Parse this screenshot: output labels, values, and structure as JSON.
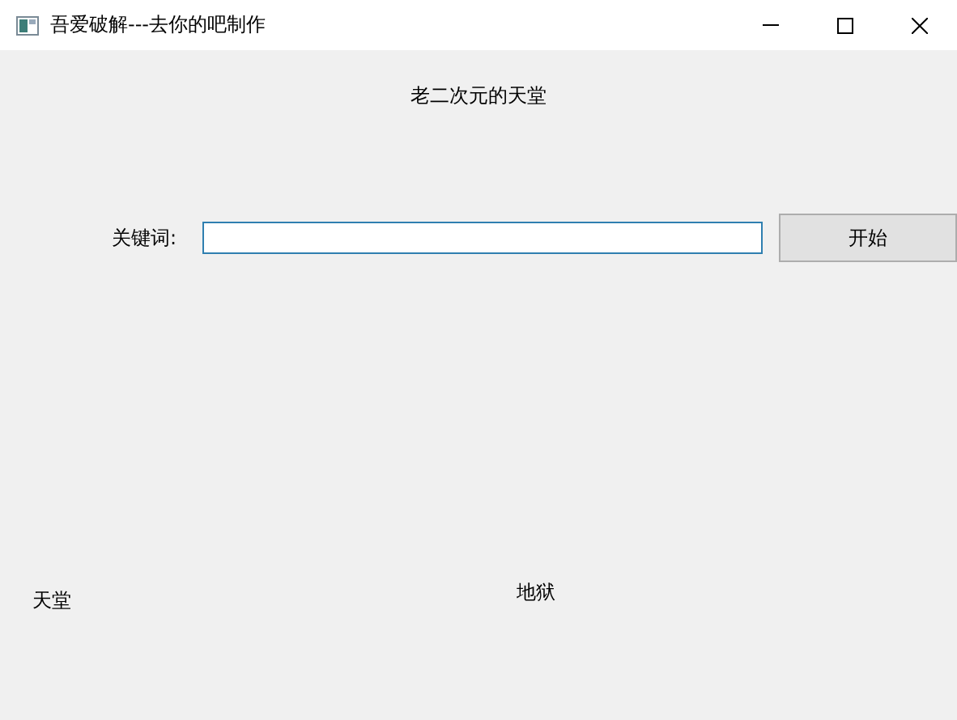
{
  "window": {
    "title": "吾爱破解---去你的吧制作"
  },
  "heading": "老二次元的天堂",
  "search": {
    "label": "关键词:"
  },
  "buttons": [
    "开始"
  ],
  "labels": [
    "天堂",
    "地狱"
  ]
}
